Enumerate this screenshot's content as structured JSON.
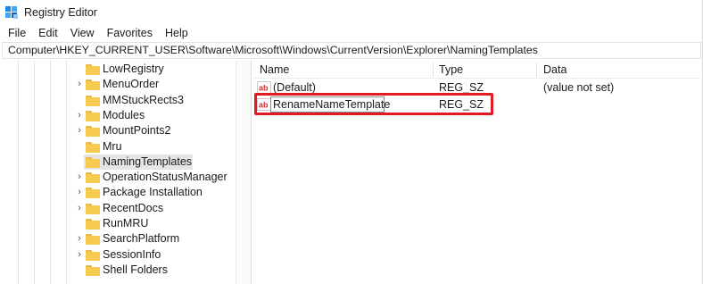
{
  "window": {
    "title": "Registry Editor"
  },
  "menu": [
    "File",
    "Edit",
    "View",
    "Favorites",
    "Help"
  ],
  "address": "Computer\\HKEY_CURRENT_USER\\Software\\Microsoft\\Windows\\CurrentVersion\\Explorer\\NamingTemplates",
  "tree": {
    "items": [
      {
        "label": "LowRegistry",
        "expandable": false,
        "selected": false
      },
      {
        "label": "MenuOrder",
        "expandable": true,
        "selected": false
      },
      {
        "label": "MMStuckRects3",
        "expandable": false,
        "selected": false
      },
      {
        "label": "Modules",
        "expandable": true,
        "selected": false
      },
      {
        "label": "MountPoints2",
        "expandable": true,
        "selected": false
      },
      {
        "label": "Mru",
        "expandable": false,
        "selected": false
      },
      {
        "label": "NamingTemplates",
        "expandable": false,
        "selected": true
      },
      {
        "label": "OperationStatusManager",
        "expandable": true,
        "selected": false
      },
      {
        "label": "Package Installation",
        "expandable": true,
        "selected": false
      },
      {
        "label": "RecentDocs",
        "expandable": true,
        "selected": false
      },
      {
        "label": "RunMRU",
        "expandable": false,
        "selected": false
      },
      {
        "label": "SearchPlatform",
        "expandable": true,
        "selected": false
      },
      {
        "label": "SessionInfo",
        "expandable": true,
        "selected": false
      },
      {
        "label": "Shell Folders",
        "expandable": false,
        "selected": false
      }
    ]
  },
  "list": {
    "columns": [
      "Name",
      "Type",
      "Data"
    ],
    "rows": [
      {
        "name": "(Default)",
        "type": "REG_SZ",
        "data": "(value not set)"
      },
      {
        "name": "RenameNameTemplate",
        "type": "REG_SZ",
        "data": ""
      }
    ]
  },
  "colors": {
    "highlight": "#e01b24",
    "selected_bg": "#e5e5e5",
    "folder": "#f6c94f"
  }
}
